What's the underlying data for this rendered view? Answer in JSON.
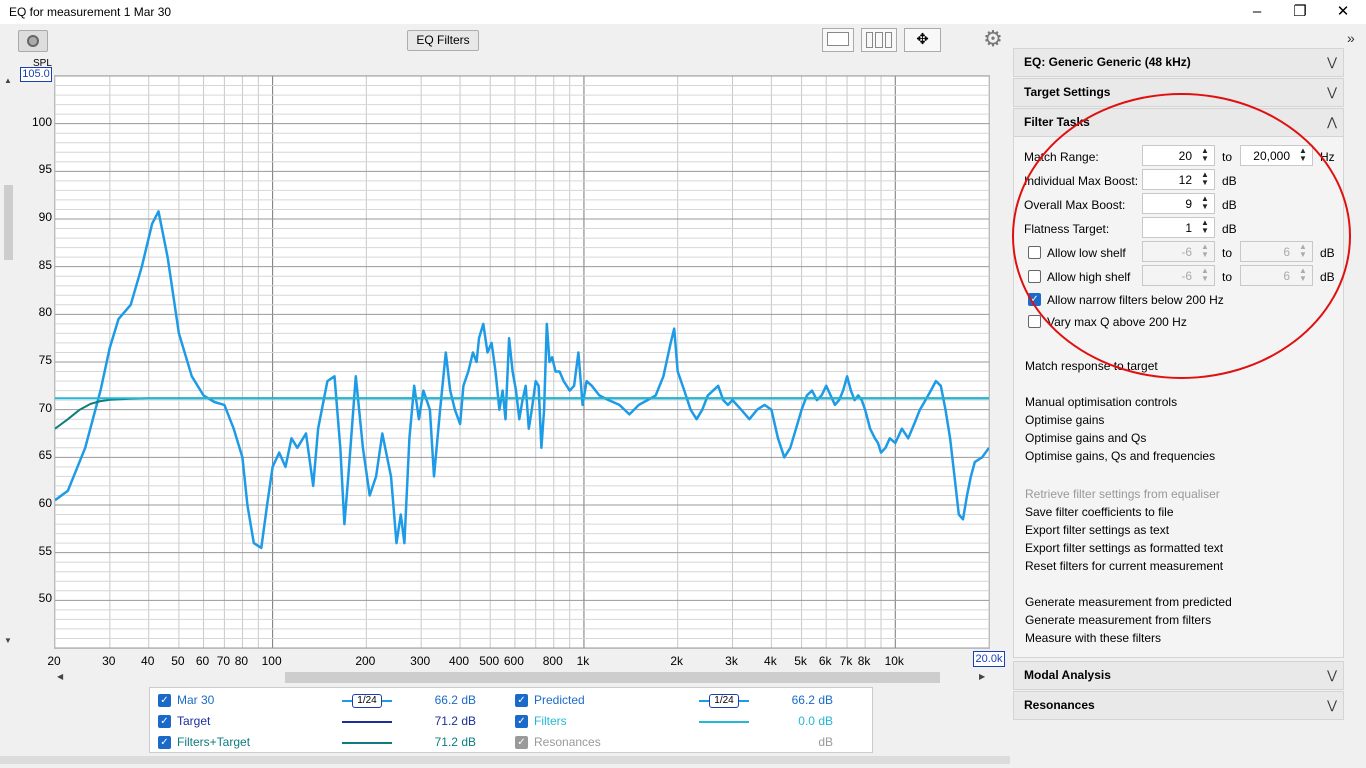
{
  "window": {
    "title": "EQ for measurement 1 Mar 30"
  },
  "toolbar": {
    "eq_filters_label": "EQ Filters",
    "icons": [
      "camera-icon",
      "single-pane-icon",
      "multi-pane-icon",
      "move-arrows-icon",
      "gear-icon"
    ]
  },
  "chart_data": {
    "type": "line",
    "ylabel": "SPL",
    "y_max_box": "105.0",
    "ylim": [
      45,
      105
    ],
    "y_ticks": [
      "100",
      "95",
      "90",
      "85",
      "80",
      "75",
      "70",
      "65",
      "60",
      "55",
      "50"
    ],
    "x_scale": "log",
    "xlim": [
      20,
      20000
    ],
    "x_max_box": "20.0k",
    "x_ticks": [
      {
        "v": 20,
        "t": "20"
      },
      {
        "v": 30,
        "t": "30"
      },
      {
        "v": 40,
        "t": "40"
      },
      {
        "v": 50,
        "t": "50"
      },
      {
        "v": 60,
        "t": "60"
      },
      {
        "v": 70,
        "t": "70"
      },
      {
        "v": 80,
        "t": "80"
      },
      {
        "v": 100,
        "t": "100"
      },
      {
        "v": 200,
        "t": "200"
      },
      {
        "v": 300,
        "t": "300"
      },
      {
        "v": 400,
        "t": "400"
      },
      {
        "v": 500,
        "t": "500"
      },
      {
        "v": 600,
        "t": "600"
      },
      {
        "v": 800,
        "t": "800"
      },
      {
        "v": 1000,
        "t": "1k"
      },
      {
        "v": 2000,
        "t": "2k"
      },
      {
        "v": 3000,
        "t": "3k"
      },
      {
        "v": 4000,
        "t": "4k"
      },
      {
        "v": 5000,
        "t": "5k"
      },
      {
        "v": 6000,
        "t": "6k"
      },
      {
        "v": 7000,
        "t": "7k"
      },
      {
        "v": 8000,
        "t": "8k"
      },
      {
        "v": 10000,
        "t": "10k"
      }
    ],
    "series": [
      {
        "name": "Mar 30",
        "color": "#1e9be6",
        "points": [
          [
            20,
            60.5
          ],
          [
            22,
            61.5
          ],
          [
            25,
            66
          ],
          [
            28,
            72
          ],
          [
            30,
            76.5
          ],
          [
            32,
            79.5
          ],
          [
            35,
            81
          ],
          [
            38,
            85
          ],
          [
            41,
            89.5
          ],
          [
            43,
            90.8
          ],
          [
            46,
            86
          ],
          [
            50,
            78
          ],
          [
            55,
            73.5
          ],
          [
            60,
            71.5
          ],
          [
            65,
            70.8
          ],
          [
            70,
            70.5
          ],
          [
            75,
            68
          ],
          [
            80,
            65
          ],
          [
            83,
            60
          ],
          [
            87,
            56
          ],
          [
            92,
            55.5
          ],
          [
            96,
            60
          ],
          [
            100,
            64
          ],
          [
            105,
            65.5
          ],
          [
            110,
            64
          ],
          [
            115,
            67
          ],
          [
            120,
            66
          ],
          [
            128,
            67.5
          ],
          [
            135,
            62
          ],
          [
            140,
            68
          ],
          [
            150,
            73
          ],
          [
            158,
            73.5
          ],
          [
            165,
            66
          ],
          [
            170,
            58
          ],
          [
            175,
            63
          ],
          [
            185,
            73.5
          ],
          [
            195,
            66
          ],
          [
            205,
            61
          ],
          [
            215,
            63
          ],
          [
            225,
            67.5
          ],
          [
            240,
            63
          ],
          [
            250,
            56
          ],
          [
            258,
            59
          ],
          [
            265,
            56
          ],
          [
            275,
            67
          ],
          [
            285,
            72.5
          ],
          [
            295,
            69
          ],
          [
            305,
            72
          ],
          [
            320,
            70
          ],
          [
            330,
            63
          ],
          [
            345,
            70
          ],
          [
            360,
            76
          ],
          [
            372,
            72
          ],
          [
            385,
            70
          ],
          [
            400,
            68.5
          ],
          [
            410,
            72.5
          ],
          [
            425,
            74
          ],
          [
            440,
            76
          ],
          [
            452,
            75
          ],
          [
            460,
            77.5
          ],
          [
            475,
            79
          ],
          [
            490,
            76
          ],
          [
            505,
            77
          ],
          [
            520,
            74
          ],
          [
            535,
            70
          ],
          [
            548,
            72
          ],
          [
            560,
            69
          ],
          [
            575,
            77.5
          ],
          [
            590,
            74
          ],
          [
            605,
            72
          ],
          [
            620,
            69
          ],
          [
            635,
            71
          ],
          [
            650,
            72.5
          ],
          [
            665,
            68
          ],
          [
            680,
            70
          ],
          [
            700,
            73
          ],
          [
            715,
            72.5
          ],
          [
            730,
            66
          ],
          [
            745,
            70
          ],
          [
            760,
            79
          ],
          [
            775,
            75
          ],
          [
            790,
            75.5
          ],
          [
            810,
            74
          ],
          [
            835,
            74
          ],
          [
            860,
            73
          ],
          [
            880,
            72.5
          ],
          [
            900,
            72
          ],
          [
            930,
            72.5
          ],
          [
            960,
            76
          ],
          [
            990,
            70.5
          ],
          [
            1020,
            73
          ],
          [
            1060,
            72.5
          ],
          [
            1120,
            71.5
          ],
          [
            1200,
            71
          ],
          [
            1300,
            70.5
          ],
          [
            1400,
            69.5
          ],
          [
            1500,
            70.5
          ],
          [
            1600,
            71
          ],
          [
            1700,
            71.5
          ],
          [
            1800,
            73.5
          ],
          [
            1900,
            77
          ],
          [
            1950,
            78.5
          ],
          [
            2000,
            74
          ],
          [
            2100,
            72
          ],
          [
            2200,
            70
          ],
          [
            2300,
            69
          ],
          [
            2400,
            70
          ],
          [
            2500,
            71.5
          ],
          [
            2600,
            72
          ],
          [
            2700,
            72.5
          ],
          [
            2800,
            71
          ],
          [
            2900,
            70.5
          ],
          [
            3000,
            71
          ],
          [
            3200,
            70
          ],
          [
            3400,
            69
          ],
          [
            3600,
            70
          ],
          [
            3800,
            70.5
          ],
          [
            4000,
            70
          ],
          [
            4200,
            67
          ],
          [
            4400,
            65
          ],
          [
            4600,
            66
          ],
          [
            4800,
            68
          ],
          [
            5000,
            70
          ],
          [
            5200,
            71.5
          ],
          [
            5400,
            72
          ],
          [
            5600,
            71
          ],
          [
            5800,
            71.5
          ],
          [
            6000,
            72.5
          ],
          [
            6200,
            71.5
          ],
          [
            6400,
            70.5
          ],
          [
            6600,
            71
          ],
          [
            6800,
            72
          ],
          [
            7000,
            73.5
          ],
          [
            7200,
            72
          ],
          [
            7400,
            71
          ],
          [
            7600,
            71.5
          ],
          [
            7800,
            71
          ],
          [
            8000,
            70
          ],
          [
            8300,
            68
          ],
          [
            8600,
            67
          ],
          [
            8800,
            66.5
          ],
          [
            9000,
            65.5
          ],
          [
            9300,
            66
          ],
          [
            9600,
            67
          ],
          [
            10000,
            66.5
          ],
          [
            10500,
            68
          ],
          [
            11000,
            67
          ],
          [
            11500,
            68.5
          ],
          [
            12000,
            70
          ],
          [
            12500,
            71
          ],
          [
            13000,
            72
          ],
          [
            13500,
            73
          ],
          [
            14000,
            72.5
          ],
          [
            14500,
            70
          ],
          [
            15000,
            67
          ],
          [
            15500,
            63
          ],
          [
            16000,
            59
          ],
          [
            16500,
            58.5
          ],
          [
            17000,
            61
          ],
          [
            17500,
            63
          ],
          [
            18000,
            64.5
          ],
          [
            19000,
            65
          ],
          [
            20000,
            66
          ]
        ]
      },
      {
        "name": "Target",
        "color": "#1a2ea0",
        "points": []
      },
      {
        "name": "Filters+Target",
        "color": "#0e7d7f",
        "points": [
          [
            20,
            68
          ],
          [
            22,
            69
          ],
          [
            24,
            70
          ],
          [
            26,
            70.6
          ],
          [
            28,
            70.9
          ],
          [
            30,
            71.05
          ],
          [
            35,
            71.15
          ],
          [
            40,
            71.2
          ],
          [
            20000,
            71.2
          ]
        ]
      },
      {
        "name": "Predicted",
        "color": "#1e9be6",
        "points": []
      },
      {
        "name": "Filters",
        "color": "#23b8d8",
        "points": [
          [
            20,
            71.2
          ],
          [
            20000,
            71.2
          ]
        ]
      }
    ]
  },
  "legend": {
    "rows": [
      {
        "label": "Mar 30",
        "smoothing": "1/24",
        "value": "66.2 dB",
        "color": "#1e9be6",
        "checked": true
      },
      {
        "label": "Target",
        "smoothing": "",
        "value": "71.2 dB",
        "color": "#1a2ea0",
        "checked": true
      },
      {
        "label": "Filters+Target",
        "smoothing": "",
        "value": "71.2 dB",
        "color": "#0e7d7f",
        "checked": true
      },
      {
        "label": "Predicted",
        "smoothing": "1/24",
        "value": "66.2 dB",
        "color": "#1e9be6",
        "checked": true
      },
      {
        "label": "Filters",
        "smoothing": "",
        "value": "0.0 dB",
        "color": "#23b8d8",
        "checked": true
      },
      {
        "label": "Resonances",
        "smoothing": "",
        "value": "dB",
        "color": "#9a9a9a",
        "checked": true,
        "disabled": true
      }
    ]
  },
  "panel": {
    "eq_header": "EQ: Generic Generic (48 kHz)",
    "target_header": "Target Settings",
    "filter_header": "Filter Tasks",
    "match_range_label": "Match Range:",
    "match_from": "20",
    "match_to_word": "to",
    "match_to": "20,000",
    "hz": "Hz",
    "ind_boost_label": "Individual Max Boost:",
    "ind_boost": "12",
    "overall_boost_label": "Overall Max Boost:",
    "overall_boost": "9",
    "flatness_label": "Flatness Target:",
    "flatness": "1",
    "db": "dB",
    "low_shelf_label": "Allow low shelf",
    "low_shelf_from": "-6",
    "low_shelf_to": "6",
    "high_shelf_label": "Allow high shelf",
    "high_shelf_from": "-6",
    "high_shelf_to": "6",
    "narrow_label": "Allow narrow filters below 200 Hz",
    "vary_q_label": "Vary max Q above 200 Hz",
    "tasks": {
      "match": "Match response to target",
      "manual": "Manual optimisation controls",
      "opt_gains": "Optimise gains",
      "opt_gains_q": "Optimise gains and Qs",
      "opt_gains_q_f": "Optimise gains, Qs and frequencies",
      "retrieve": "Retrieve filter settings from equaliser",
      "save_coeff": "Save filter coefficients to file",
      "export_text": "Export filter settings as text",
      "export_formatted": "Export filter settings as formatted text",
      "reset": "Reset filters for current measurement",
      "gen_predicted": "Generate measurement from predicted",
      "gen_filters": "Generate measurement from filters",
      "measure_with": "Measure with these filters"
    },
    "modal_header": "Modal Analysis",
    "resonances_header": "Resonances"
  }
}
